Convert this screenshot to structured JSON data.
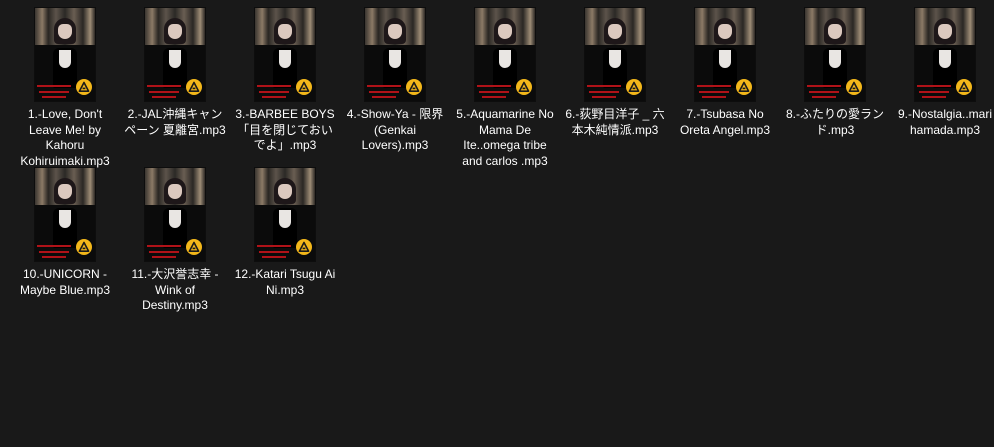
{
  "files": [
    {
      "name": "1.-Love, Don't Leave Me! by Kahoru Kohiruimaki.mp3",
      "thumbnail_icon": "album-art-thumbnail",
      "badge_icon": "audio-file-icon"
    },
    {
      "name": "2.-JAL沖縄キャンペーン 夏離宮.mp3",
      "thumbnail_icon": "album-art-thumbnail",
      "badge_icon": "audio-file-icon"
    },
    {
      "name": "3.-BARBEE BOYS「目を閉じておいでよ」.mp3",
      "thumbnail_icon": "album-art-thumbnail",
      "badge_icon": "audio-file-icon"
    },
    {
      "name": "4.-Show-Ya - 限界 (Genkai Lovers).mp3",
      "thumbnail_icon": "album-art-thumbnail",
      "badge_icon": "audio-file-icon"
    },
    {
      "name": "5.-Aquamarine No Mama De Ite..omega tribe and carlos .mp3",
      "thumbnail_icon": "album-art-thumbnail",
      "badge_icon": "audio-file-icon"
    },
    {
      "name": "6.-荻野目洋子 _ 六本木純情派.mp3",
      "thumbnail_icon": "album-art-thumbnail",
      "badge_icon": "audio-file-icon"
    },
    {
      "name": "7.-Tsubasa No Oreta Angel.mp3",
      "thumbnail_icon": "album-art-thumbnail",
      "badge_icon": "audio-file-icon"
    },
    {
      "name": "8.-ふたりの愛ランド.mp3",
      "thumbnail_icon": "album-art-thumbnail",
      "badge_icon": "audio-file-icon"
    },
    {
      "name": "9.-Nostalgia..mari hamada.mp3",
      "thumbnail_icon": "album-art-thumbnail",
      "badge_icon": "audio-file-icon"
    },
    {
      "name": "10.-UNICORN - Maybe Blue.mp3",
      "thumbnail_icon": "album-art-thumbnail",
      "badge_icon": "audio-file-icon"
    },
    {
      "name": "11.-大沢誉志幸 - Wink of Destiny.mp3",
      "thumbnail_icon": "album-art-thumbnail",
      "badge_icon": "audio-file-icon"
    },
    {
      "name": "12.-Katari Tsugu Ai Ni.mp3",
      "thumbnail_icon": "album-art-thumbnail",
      "badge_icon": "audio-file-icon"
    }
  ],
  "colors": {
    "background": "#191919",
    "text": "#ffffff",
    "badge": "#f3b71a",
    "caption_red": "#b01218"
  }
}
